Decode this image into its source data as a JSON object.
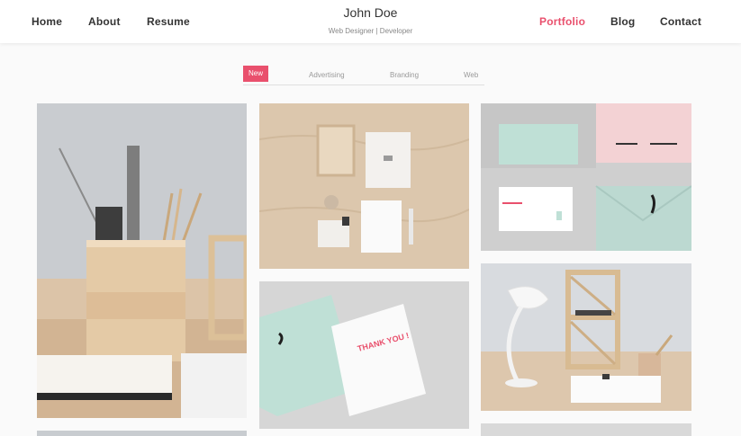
{
  "nav": {
    "left": [
      {
        "label": "Home"
      },
      {
        "label": "About"
      },
      {
        "label": "Resume"
      }
    ],
    "right": [
      {
        "label": "Portfolio",
        "active": true
      },
      {
        "label": "Blog"
      },
      {
        "label": "Contact"
      }
    ]
  },
  "brand": {
    "name": "John Doe",
    "tagline": "Web Designer | Developer"
  },
  "filters": [
    {
      "label": "New",
      "active": true
    },
    {
      "label": "Advertising"
    },
    {
      "label": "Branding"
    },
    {
      "label": "Web"
    }
  ],
  "gallery": {
    "thank_you_text": "THANK YOU !"
  },
  "colors": {
    "accent": "#e9506d",
    "header_bg": "#ffffff",
    "page_bg": "#fafafa",
    "nav_text": "#333333"
  }
}
